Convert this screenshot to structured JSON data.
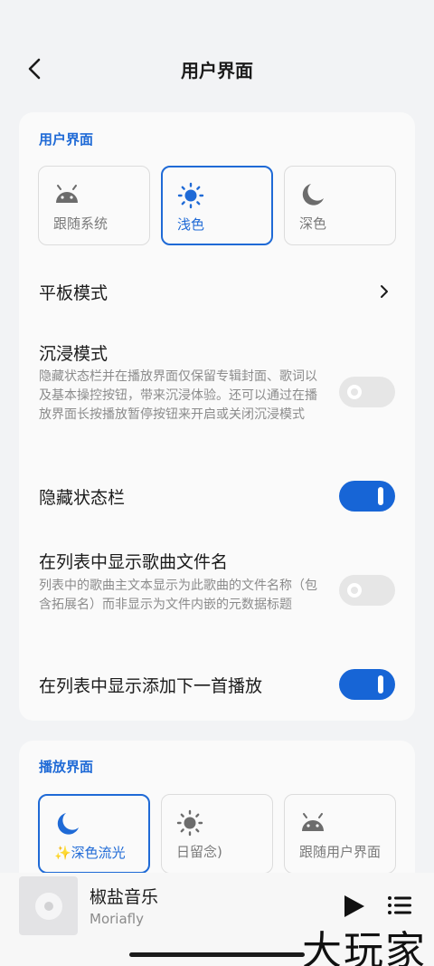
{
  "header": {
    "title": "用户界面",
    "back_icon": "back-arrow-icon"
  },
  "ui_section": {
    "title": "用户界面",
    "theme_options": [
      {
        "label": "跟随系统",
        "icon": "android-icon",
        "selected": false
      },
      {
        "label": "浅色",
        "icon": "sun-icon",
        "selected": true
      },
      {
        "label": "深色",
        "icon": "moon-icon",
        "selected": false
      }
    ],
    "tablet_mode": {
      "label": "平板模式",
      "icon": "chevron-right-icon"
    },
    "immersive_mode": {
      "label": "沉浸模式",
      "description": "隐藏状态栏并在播放界面仅保留专辑封面、歌词以及基本操控按钮，带来沉浸体验。还可以通过在播放界面长按播放暂停按钮来开启或关闭沉浸模式",
      "enabled": false
    },
    "hide_status_bar": {
      "label": "隐藏状态栏",
      "enabled": true
    },
    "show_filename": {
      "label": "在列表中显示歌曲文件名",
      "description": "列表中的歌曲主文本显示为此歌曲的文件名称（包含拓展名）而非显示为文件内嵌的元数据标题",
      "enabled": false
    },
    "show_add_next": {
      "label": "在列表中显示添加下一首播放",
      "enabled": true
    }
  },
  "player_section": {
    "title": "播放界面",
    "style_options": [
      {
        "label": "✨深色流光",
        "icon": "moon-icon",
        "selected": true
      },
      {
        "label": "日留念)",
        "icon": "sun-icon",
        "selected": false
      },
      {
        "label": "跟随用户界面",
        "icon": "android-icon",
        "selected": false
      }
    ]
  },
  "mini_player": {
    "song": "椒盐音乐",
    "artist": "Moriafly",
    "play_icon": "play-icon",
    "queue_icon": "queue-list-icon"
  },
  "watermark": "大玩家",
  "colors": {
    "accent": "#1f6ad6",
    "toggle_on": "#1765d6",
    "toggle_off": "#e6e6e6",
    "background": "#f2f3f5",
    "card": "#fafafa"
  }
}
